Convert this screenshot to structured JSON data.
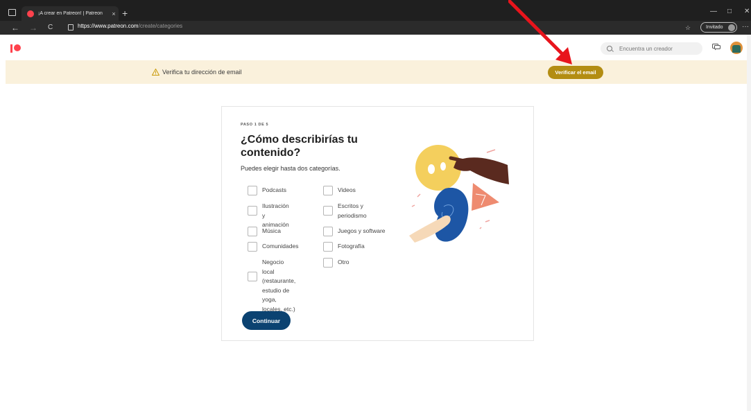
{
  "browser": {
    "tab_title": "¡A crear en Patreon! | Patreon",
    "tab_close": "×",
    "new_tab": "+",
    "url_host": "https://www.patreon.com",
    "url_path": "/create/categories",
    "profile_label": "Invitado",
    "nav": {
      "back": "←",
      "forward": "→",
      "reload": "C"
    },
    "window_controls": {
      "minimize": "—",
      "restore": "□",
      "close": "✕"
    },
    "more": "···",
    "favorites_icon": "☆"
  },
  "topnav": {
    "search_placeholder": "Encuentra un creador"
  },
  "banner": {
    "message": "Verifica tu dirección de email",
    "button": "Verificar el email",
    "accent": "#b38d12",
    "background": "#faf1dc"
  },
  "card": {
    "step": "PASO 1 DE 5",
    "title": "¿Cómo describirías tu contenido?",
    "hint": "Puedes elegir hasta dos categorías.",
    "options_left": [
      "Podcasts",
      "Ilustración y\nanimación",
      "Música",
      "Comunidades",
      "Negocio local\n(restaurante,\nestudio de yoga,\nlocales, etc.)"
    ],
    "options_right": [
      "Videos",
      "Escritos y\nperiodismo",
      "Juegos y software",
      "Fotografía",
      "Otro"
    ],
    "continue": "Continuar",
    "button_color": "#0b4271"
  },
  "icons": {
    "logo": "patreon-logo",
    "search": "search-icon",
    "chat": "chat-icon",
    "avatar": "user-avatar",
    "warning": "warning-icon"
  },
  "annotation": {
    "arrow_color": "#e8141c"
  }
}
